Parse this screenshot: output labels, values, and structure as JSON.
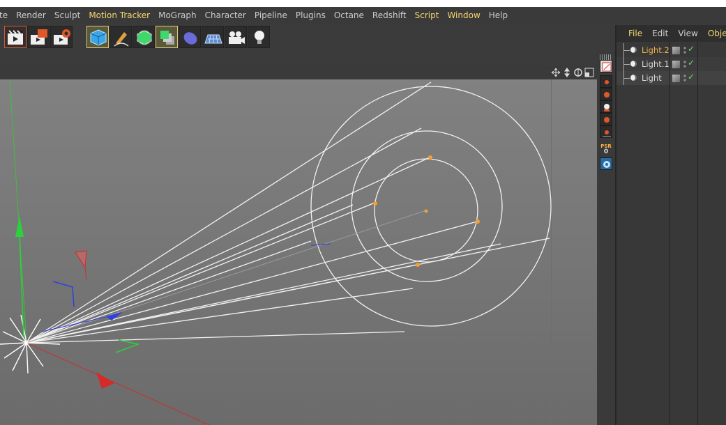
{
  "menubar": {
    "items": [
      {
        "label": "te",
        "highlight": false
      },
      {
        "label": "Render",
        "highlight": false
      },
      {
        "label": "Sculpt",
        "highlight": false
      },
      {
        "label": "Motion Tracker",
        "highlight": true
      },
      {
        "label": "MoGraph",
        "highlight": false
      },
      {
        "label": "Character",
        "highlight": false
      },
      {
        "label": "Pipeline",
        "highlight": false
      },
      {
        "label": "Plugins",
        "highlight": false
      },
      {
        "label": "Octane",
        "highlight": false
      },
      {
        "label": "Redshift",
        "highlight": false
      },
      {
        "label": "Script",
        "highlight": true
      },
      {
        "label": "Window",
        "highlight": true
      },
      {
        "label": "Help",
        "highlight": false
      }
    ]
  },
  "toolbar": {
    "render_group": [
      "render-view-icon",
      "render-picture-viewer-icon",
      "render-settings-icon"
    ],
    "create_group": [
      "cube-icon",
      "pen-spline-icon",
      "subdivision-icon",
      "cloner-icon",
      "deformer-icon",
      "floor-icon",
      "camera-icon",
      "light-bulb-icon"
    ]
  },
  "right_strip": {
    "psr_label": "PSR",
    "psr_value": "0"
  },
  "object_manager": {
    "menu": [
      {
        "label": "File",
        "highlight": true
      },
      {
        "label": "Edit",
        "highlight": false
      },
      {
        "label": "View",
        "highlight": false
      },
      {
        "label": "Obje",
        "highlight": true
      }
    ],
    "objects": [
      {
        "name": "Light.2",
        "active": true
      },
      {
        "name": "Light.1",
        "active": false
      },
      {
        "name": "Light",
        "active": false
      }
    ],
    "check_glyph": "✓"
  },
  "colors": {
    "accent": "#f5d76e",
    "active_object": "#f0b24a",
    "axis_x": "#d42a2a",
    "axis_y": "#2bd13a",
    "axis_z": "#2f3fe0",
    "handle": "#f5a030"
  }
}
